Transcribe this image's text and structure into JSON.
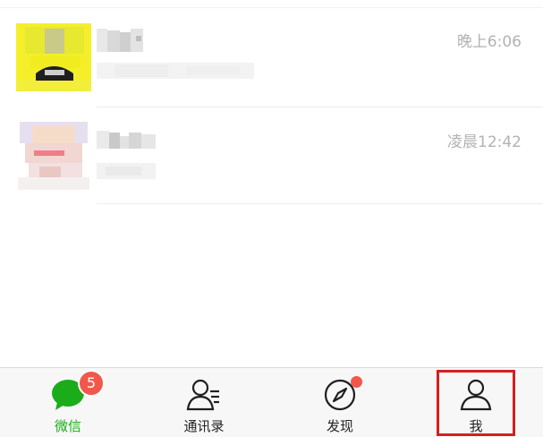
{
  "chats": [
    {
      "time": "晚上6:06"
    },
    {
      "time": "凌晨12:42"
    }
  ],
  "tabbar": {
    "tabs": [
      {
        "label": "微信",
        "icon": "chat-bubble-icon",
        "badge": "5"
      },
      {
        "label": "通讯录",
        "icon": "contacts-icon"
      },
      {
        "label": "发现",
        "icon": "compass-icon"
      },
      {
        "label": "我",
        "icon": "person-icon"
      }
    ]
  },
  "colors": {
    "accent": "#1aad19",
    "badge": "#f2574c",
    "highlight": "#d42020"
  }
}
